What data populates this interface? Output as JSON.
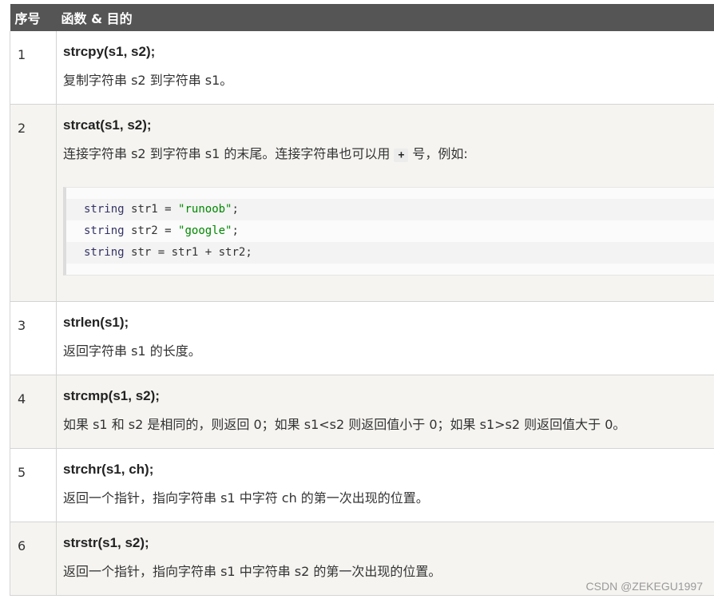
{
  "header": {
    "col_num": "序号",
    "col_func": "函数 & 目的"
  },
  "rows": [
    {
      "num": "1",
      "func": "strcpy(s1, s2);",
      "desc": "复制字符串 s2 到字符串 s1。"
    },
    {
      "num": "2",
      "func": "strcat(s1, s2);",
      "desc_before": "连接字符串 s2 到字符串 s1 的末尾。连接字符串也可以用 ",
      "desc_code": "+",
      "desc_after": " 号，例如:",
      "code": [
        {
          "type": "string",
          "name": "str1",
          "op": "=",
          "value": "\"runoob\"",
          "end": ";"
        },
        {
          "type": "string",
          "name": "str2",
          "op": "=",
          "value": "\"google\"",
          "end": ";"
        },
        {
          "type": "string",
          "name": "str",
          "op": "=",
          "value": "str1 + str2",
          "end": ";"
        }
      ]
    },
    {
      "num": "3",
      "func": "strlen(s1);",
      "desc": "返回字符串 s1 的长度。"
    },
    {
      "num": "4",
      "func": "strcmp(s1, s2);",
      "desc": "如果 s1 和 s2 是相同的，则返回 0；如果 s1<s2 则返回值小于 0；如果 s1>s2 则返回值大于 0。"
    },
    {
      "num": "5",
      "func": "strchr(s1, ch);",
      "desc": "返回一个指针，指向字符串 s1 中字符 ch 的第一次出现的位置。"
    },
    {
      "num": "6",
      "func": "strstr(s1, s2);",
      "desc": "返回一个指针，指向字符串 s1 中字符串 s2 的第一次出现的位置。"
    }
  ],
  "watermark": "CSDN @ZEKEGU1997",
  "colors": {
    "header_bg": "#555555",
    "string_literal": "#008800",
    "keyword": "#333366"
  }
}
